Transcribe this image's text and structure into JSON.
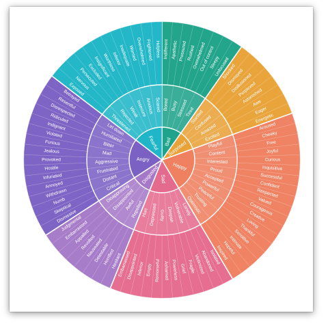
{
  "wheel": {
    "title": "",
    "emotions": [
      {
        "name": "Bad",
        "color": "#1fa38a",
        "subs": [
          {
            "name": "Bored",
            "leaves": [
              "Indifferent",
              "Apathetic"
            ]
          },
          {
            "name": "Busy",
            "leaves": [
              "Pressured",
              "Rushed"
            ]
          },
          {
            "name": "Stressed",
            "leaves": [
              "Overwhelmed",
              "Out of control"
            ]
          },
          {
            "name": "Tired",
            "leaves": [
              "Sleepy",
              "Unfocused"
            ]
          }
        ]
      },
      {
        "name": "Surprised",
        "color": "#e9a238",
        "subs": [
          {
            "name": "Startled",
            "leaves": [
              "Shocked",
              "Dismayed"
            ]
          },
          {
            "name": "Confused",
            "leaves": [
              "Disillusioned",
              "Perplexed"
            ]
          },
          {
            "name": "Amazed",
            "leaves": [
              "Astonished",
              "Awe"
            ]
          },
          {
            "name": "Excited",
            "leaves": [
              "Eager",
              "Energetic"
            ]
          }
        ]
      },
      {
        "name": "Happy",
        "color": "#ef8060",
        "subs": [
          {
            "name": "Playful",
            "leaves": [
              "Aroused",
              "Cheeky"
            ]
          },
          {
            "name": "Content",
            "leaves": [
              "Free",
              "Joyful"
            ]
          },
          {
            "name": "Interested",
            "leaves": [
              "Curious",
              "Inquisitive"
            ]
          },
          {
            "name": "Proud",
            "leaves": [
              "Successful",
              "Confident"
            ]
          },
          {
            "name": "Accepted",
            "leaves": [
              "Respected",
              "Valued"
            ]
          },
          {
            "name": "Powerful",
            "leaves": [
              "Courageous",
              "Creative"
            ]
          },
          {
            "name": "Peaceful",
            "leaves": [
              "Loving",
              "Thankful"
            ]
          },
          {
            "name": "Trusting",
            "leaves": [
              "Sensitive",
              "Intimate"
            ]
          },
          {
            "name": "Optimistic",
            "leaves": [
              "Hopeful",
              "Inspired"
            ]
          }
        ]
      },
      {
        "name": "Sad",
        "color": "#e56b8e",
        "subs": [
          {
            "name": "Lonely",
            "leaves": [
              "Isolated",
              "Abandoned"
            ]
          },
          {
            "name": "Vulnerable",
            "leaves": [
              "Victimized",
              "Fragile"
            ]
          },
          {
            "name": "Despair",
            "leaves": [
              "Grief",
              "Powerless"
            ]
          },
          {
            "name": "Guilty",
            "leaves": [
              "Ashamed",
              "Remorseful"
            ]
          },
          {
            "name": "Depressed",
            "leaves": [
              "Empty",
              "Inferior"
            ]
          },
          {
            "name": "Hurt",
            "leaves": [
              "Disappointed",
              "Embarrassed"
            ]
          }
        ]
      },
      {
        "name": "Disgusted",
        "color": "#a579c8",
        "subs": [
          {
            "name": "Repelled",
            "leaves": [
              "Hesitant",
              "Horrified"
            ]
          },
          {
            "name": "Awful",
            "leaves": [
              "Detestable",
              "Nauseated"
            ]
          },
          {
            "name": "Disappointed",
            "leaves": [
              "Revolted",
              "Appalled"
            ]
          },
          {
            "name": "Disapproving",
            "leaves": [
              "Embarrassed",
              "Judgmental"
            ]
          }
        ]
      },
      {
        "name": "Angry",
        "color": "#7b61c4",
        "subs": [
          {
            "name": "Critical",
            "leaves": [
              "Dismissive",
              "Skeptical"
            ]
          },
          {
            "name": "Distant",
            "leaves": [
              "Numb",
              "Withdrawn"
            ]
          },
          {
            "name": "Frustrated",
            "leaves": [
              "Annoyed",
              "Infuriated"
            ]
          },
          {
            "name": "Aggressive",
            "leaves": [
              "Hostile",
              "Provoked"
            ]
          },
          {
            "name": "Mad",
            "leaves": [
              "Jealous",
              "Furious"
            ]
          },
          {
            "name": "Bitter",
            "leaves": [
              "Violated",
              "Indignant"
            ]
          },
          {
            "name": "Humiliated",
            "leaves": [
              "Ridiculed",
              "Disrespected"
            ]
          },
          {
            "name": "Let down",
            "leaves": [
              "Resentful",
              "Betrayed"
            ]
          }
        ]
      },
      {
        "name": "Fearful",
        "color": "#20b6c7",
        "subs": [
          {
            "name": "Threatened",
            "leaves": [
              "Exposed",
              "Nervous"
            ]
          },
          {
            "name": "Rejected",
            "leaves": [
              "Persecuted",
              "Excluded"
            ]
          },
          {
            "name": "Weak",
            "leaves": [
              "Insignificant",
              "Worthless"
            ]
          },
          {
            "name": "Insecure",
            "leaves": [
              "Inferior",
              "Inadequate"
            ]
          },
          {
            "name": "Anxious",
            "leaves": [
              "Worried",
              "Overwhelmed"
            ]
          },
          {
            "name": "Scared",
            "leaves": [
              "Frightened",
              "Helpless"
            ]
          }
        ]
      }
    ]
  }
}
